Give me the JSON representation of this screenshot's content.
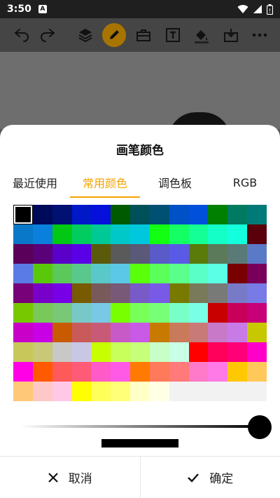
{
  "status_bar": {
    "time": "3:50",
    "notif_letter": "A"
  },
  "toolbar": {
    "icons": [
      "undo-icon",
      "redo-icon",
      "layers-icon",
      "pen-icon",
      "toolbox-icon",
      "text-icon",
      "fill-icon",
      "download-icon",
      "more-icon"
    ],
    "active": "pen-icon"
  },
  "dialog": {
    "title": "画笔颜色",
    "tabs": [
      {
        "label": "最近使用",
        "selected": false
      },
      {
        "label": "常用颜色",
        "selected": true
      },
      {
        "label": "调色板",
        "selected": false
      },
      {
        "label": "RGB",
        "selected": false
      }
    ],
    "palette": [
      [
        "#000000",
        "#000a5a",
        "#001073",
        "#0018c8",
        "#0510dc",
        "#005a00",
        "#00505a",
        "#005073",
        "#0050c8",
        "#0050dc",
        "#008000",
        "#007a60",
        "#007a78"
      ],
      [
        "#0a78c8",
        "#0a80dc",
        "#00c814",
        "#00cc60",
        "#00c896",
        "#00c8c8",
        "#00c8dc",
        "#12ff14",
        "#14ff64",
        "#14ff96",
        "#14ffc8",
        "#14ffdc",
        "#5a000a"
      ],
      [
        "#5a005a",
        "#5a0078",
        "#5a00c8",
        "#5a00e6",
        "#5a5a0a",
        "#5a5a5a",
        "#5a5a78",
        "#5a5ac8",
        "#5a5ae6",
        "#5a7a0a",
        "#5a7a5a",
        "#5a7a78",
        "#5a7ac8"
      ],
      [
        "#5a7ae6",
        "#5ac80a",
        "#5ac85a",
        "#5ac88c",
        "#5ac8c8",
        "#5ac8e6",
        "#5aff0a",
        "#5aff5a",
        "#5aff8c",
        "#5affc8",
        "#5affe6",
        "#780000",
        "#78005a"
      ],
      [
        "#780078",
        "#7800c8",
        "#7800e6",
        "#785a00",
        "#785a5a",
        "#785a78",
        "#785ac8",
        "#785ae6",
        "#787a00",
        "#787a5a",
        "#787a78",
        "#787ac8",
        "#787ae6"
      ],
      [
        "#78c800",
        "#78c85a",
        "#78c878",
        "#78c8c8",
        "#78c8e6",
        "#78ff00",
        "#78ff5a",
        "#78ff78",
        "#78ffc8",
        "#78ffe6",
        "#c80000",
        "#c8005a",
        "#c80078"
      ],
      [
        "#c800c8",
        "#c800e6",
        "#c85a00",
        "#c85a5a",
        "#c85a78",
        "#c85ac8",
        "#c85ae6",
        "#c87a00",
        "#c87a5a",
        "#c87a78",
        "#c87ac8",
        "#c87ae6",
        "#c8c800"
      ],
      [
        "#c8c85a",
        "#c8c878",
        "#c8c8c8",
        "#c8c8e6",
        "#c8ff00",
        "#c8ff5a",
        "#c8ff78",
        "#c8ffc8",
        "#c8ffe6",
        "#ff0000",
        "#ff005a",
        "#ff0078",
        "#ff00c8"
      ],
      [
        "#ff00e6",
        "#ff5a00",
        "#ff5a5a",
        "#ff5a78",
        "#ff5ac8",
        "#ff5ae6",
        "#ff7a00",
        "#ff7a5a",
        "#ff7a78",
        "#ff7ac8",
        "#ff7ae6",
        "#ffc800",
        "#ffc85a"
      ],
      [
        "#ffc878",
        "#ffc8c8",
        "#ffc8e6",
        "#ffff00",
        "#ffff5a",
        "#ffff78",
        "#ffffc8",
        "#ffffe6",
        "#f2f2f2",
        "#f2f2f2",
        "#f2f2f2",
        "#f2f2f2",
        "#f2f2f2"
      ]
    ],
    "selected_color": "#000000",
    "brightness_percent": 100,
    "buttons": {
      "cancel": "取消",
      "confirm": "确定"
    }
  }
}
